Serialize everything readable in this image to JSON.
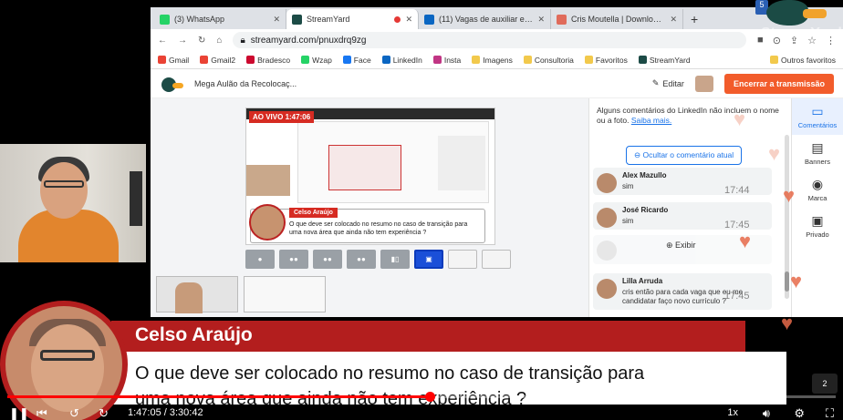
{
  "browser": {
    "tabs": [
      {
        "title": "(3) WhatsApp",
        "color": "#25d366",
        "active": false
      },
      {
        "title": "StreamYard",
        "color": "#1c4b46",
        "active": true,
        "recording": true
      },
      {
        "title": "(11) Vagas de auxiliar escrit",
        "color": "#0a66c2",
        "active": false
      },
      {
        "title": "Cris Moutella | Download | M",
        "color": "#e06b5b",
        "active": false
      }
    ],
    "new_tab": "+",
    "url": "streamyard.com/pnuxdrq9zg",
    "bookmarks": [
      "Gmail",
      "Gmail2",
      "Bradesco",
      "Wzap",
      "Face",
      "LinkedIn",
      "Insta",
      "Imagens",
      "Consultoria",
      "Favoritos",
      "StreamYard"
    ],
    "bookmarks_right": "Outros favoritos"
  },
  "streamyard": {
    "studio_title": "Mega Aulão da Recolocaç...",
    "edit_label": "Editar",
    "end_button": "Encerrar a transmissão",
    "live_badge": "AO VIVO 1:47:06",
    "preview_name": "Celso Araújo",
    "preview_question": "O que deve ser colocado no resumo no caso de transição para uma nova área que ainda não tem experiência ?",
    "chat_note": "Alguns comentários do LinkedIn não incluem o nome ou a foto.",
    "chat_note_link": "Saiba mais.",
    "hide_button": "Ocultar o comentário atual",
    "show_button": "Exibir",
    "messages": [
      {
        "name": "Alex Mazullo",
        "time": "17:44",
        "text": "sim"
      },
      {
        "name": "José Ricardo",
        "time": "17:45",
        "text": "sim"
      },
      {
        "name": "",
        "time": "",
        "text": ""
      },
      {
        "name": "Lilla Arruda",
        "time": "17:45",
        "text": "cris então para cada vaga que eu me candidatar faço novo currículo ?"
      }
    ],
    "rail": [
      {
        "label": "Comentários",
        "icon": "comment-icon"
      },
      {
        "label": "Banners",
        "icon": "banner-icon"
      },
      {
        "label": "Marca",
        "icon": "palette-icon"
      },
      {
        "label": "Privado",
        "icon": "chat-icon"
      }
    ]
  },
  "lower_third": {
    "name": "Celso Araújo",
    "line1": "O que deve ser colocado no resumo no caso de transição para",
    "line2": "uma nova área que ainda não tem experiência ?"
  },
  "watermark": {
    "brand": "StreamYard",
    "badge": "5"
  },
  "player": {
    "time": "1:47:05 / 3:30:42",
    "progress": 0.51,
    "speed": "1x",
    "chat_count": "2"
  }
}
